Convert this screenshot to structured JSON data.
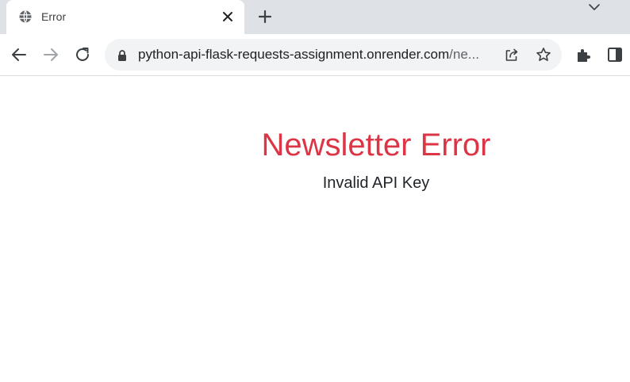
{
  "tab": {
    "title": "Error",
    "favicon": "globe-icon",
    "close_icon": "close-icon",
    "new_tab_icon": "plus-icon"
  },
  "toolbar": {
    "back_icon": "back-arrow-icon",
    "forward_icon": "forward-arrow-icon",
    "reload_icon": "reload-icon",
    "lock_icon": "lock-icon",
    "share_icon": "share-icon",
    "bookmark_icon": "star-icon",
    "extensions_icon": "puzzle-icon",
    "side_panel_icon": "side-panel-icon"
  },
  "omnibox": {
    "host": "python-api-flask-requests-assignment.onrender.com",
    "path": "/ne..."
  },
  "page": {
    "heading": "Newsletter Error",
    "message": "Invalid API Key"
  },
  "colors": {
    "heading": "#dc3545",
    "tab_strip": "#dee1e6",
    "omnibox": "#f1f3f4"
  }
}
